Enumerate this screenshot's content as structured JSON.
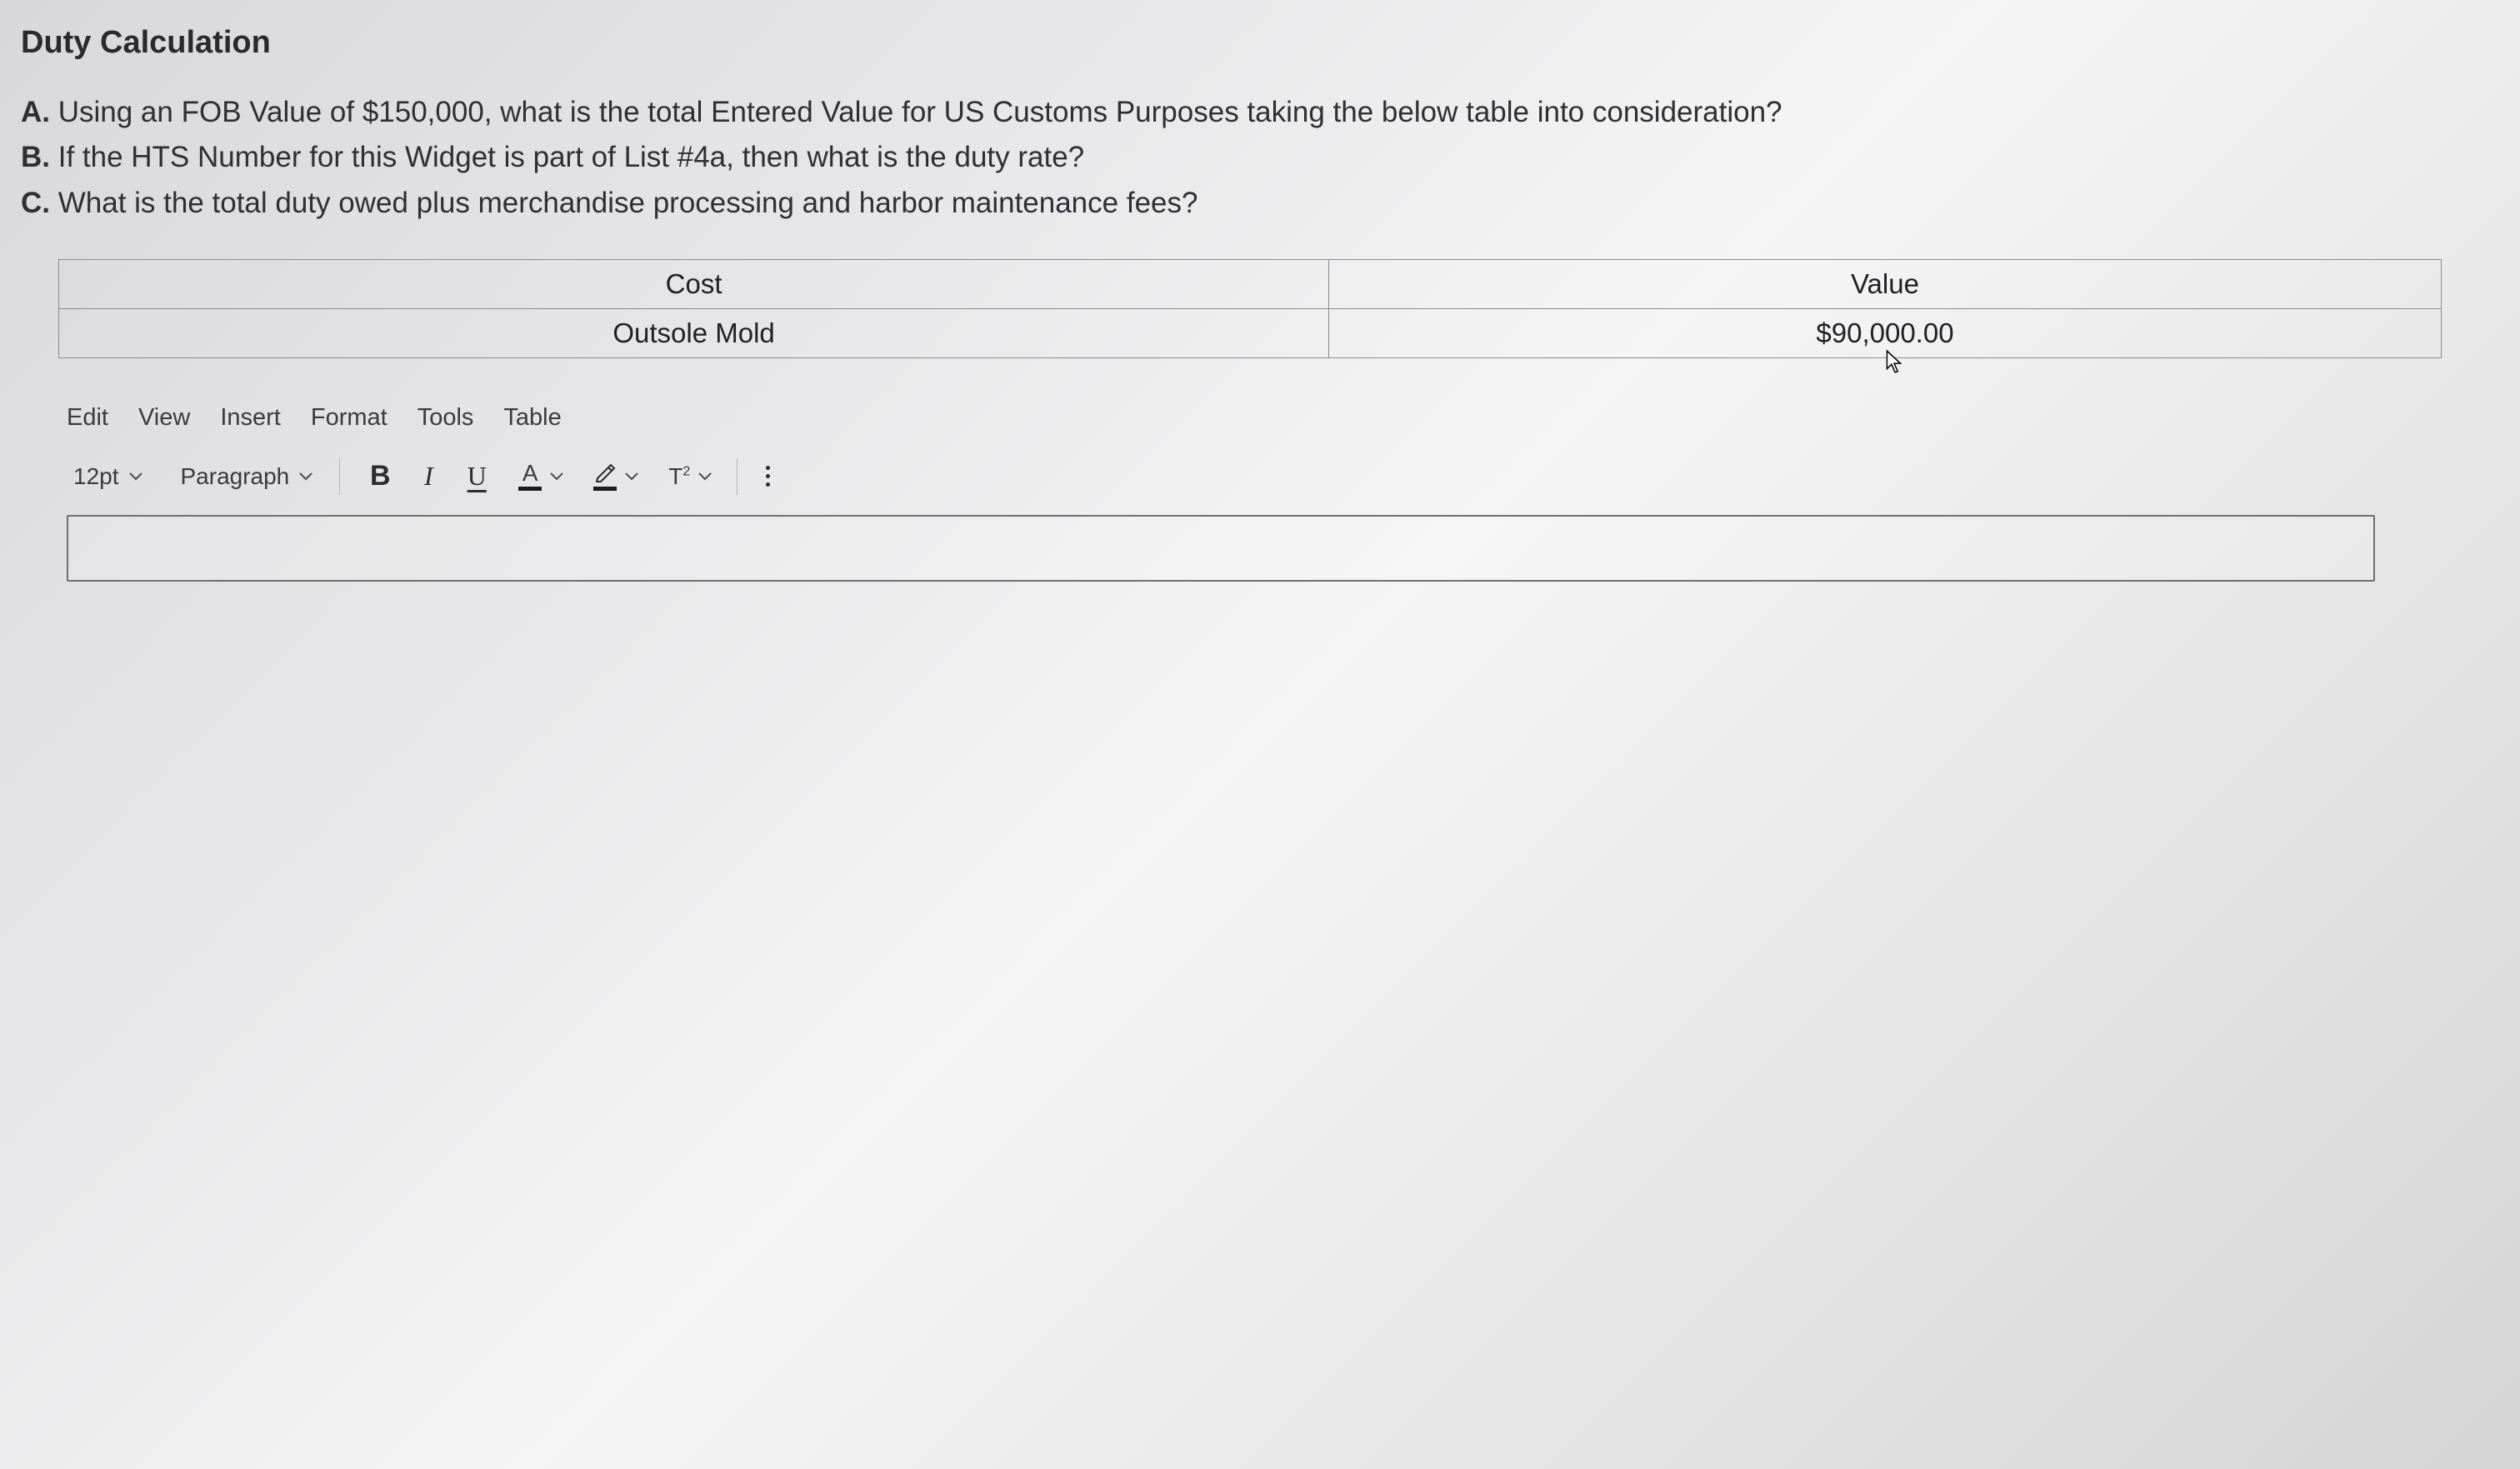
{
  "heading": "Duty Calculation",
  "questions": {
    "a": {
      "label": "A.",
      "text": " Using an FOB Value of $150,000, what is the total Entered Value for US Customs Purposes taking the below table into consideration?"
    },
    "b": {
      "label": "B.",
      "text": " If the HTS Number for this Widget is part of List #4a, then what is the duty rate?"
    },
    "c": {
      "label": "C.",
      "text": " What is the total duty owed plus merchandise processing and harbor maintenance fees?"
    }
  },
  "table": {
    "headers": {
      "col1": "Cost",
      "col2": "Value"
    },
    "rows": [
      {
        "cost": "Outsole Mold",
        "value": "$90,000.00"
      }
    ]
  },
  "editor": {
    "menubar": {
      "edit": "Edit",
      "view": "View",
      "insert": "Insert",
      "format": "Format",
      "tools": "Tools",
      "table": "Table"
    },
    "toolbar": {
      "fontsize": "12pt",
      "blockformat": "Paragraph",
      "bold": "B",
      "italic": "I",
      "underline": "U",
      "textcolor_letter": "A",
      "supsub": "T"
    }
  }
}
